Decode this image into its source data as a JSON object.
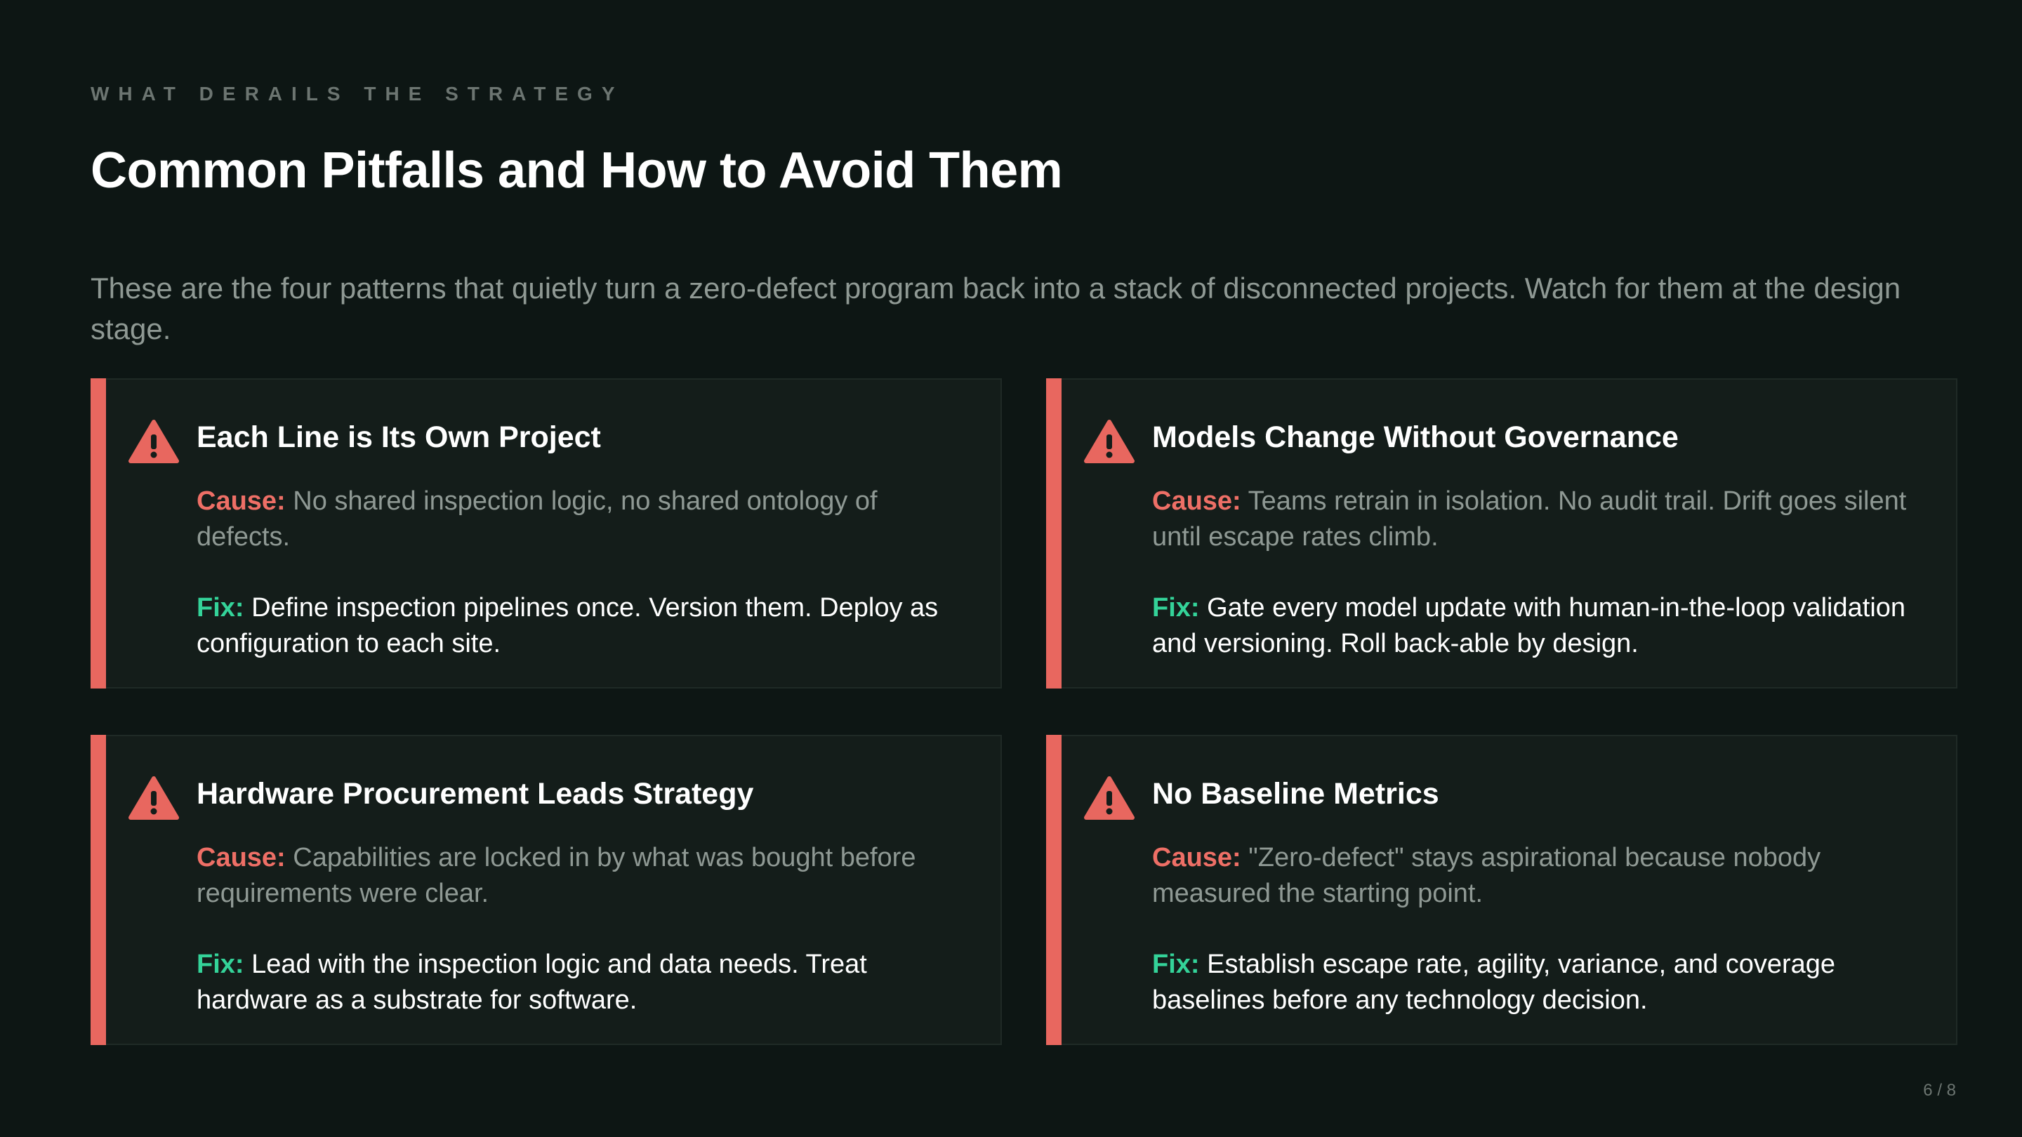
{
  "eyebrow": "WHAT DERAILS THE STRATEGY",
  "title": "Common Pitfalls and How to Avoid Them",
  "subtitle": "These are the four patterns that quietly turn a zero-defect program back into a stack of disconnected projects. Watch for them at the design stage.",
  "colors": {
    "background": "#0d1614",
    "card_background": "#141d1a",
    "accent_red": "#e8675f",
    "fix_green": "#34d399",
    "muted_text": "#8f9994"
  },
  "cards": [
    {
      "icon": "warning-triangle-icon",
      "title": "Each Line is Its Own Project",
      "cause_label": "Cause:",
      "cause_text": "No shared inspection logic, no shared ontology of defects.",
      "fix_label": "Fix:",
      "fix_text": "Define inspection pipelines once. Version them. Deploy as configuration to each site."
    },
    {
      "icon": "warning-triangle-icon",
      "title": "Models Change Without Governance",
      "cause_label": "Cause:",
      "cause_text": "Teams retrain in isolation. No audit trail. Drift goes silent until escape rates climb.",
      "fix_label": "Fix:",
      "fix_text": "Gate every model update with human-in-the-loop validation and versioning. Roll back-able by design."
    },
    {
      "icon": "warning-triangle-icon",
      "title": "Hardware Procurement Leads Strategy",
      "cause_label": "Cause:",
      "cause_text": "Capabilities are locked in by what was bought before requirements were clear.",
      "fix_label": "Fix:",
      "fix_text": "Lead with the inspection logic and data needs. Treat hardware as a substrate for software."
    },
    {
      "icon": "warning-triangle-icon",
      "title": "No Baseline Metrics",
      "cause_label": "Cause:",
      "cause_text": "\"Zero-defect\" stays aspirational because nobody measured the starting point.",
      "fix_label": "Fix:",
      "fix_text": "Establish escape rate, agility, variance, and coverage baselines before any technology decision."
    }
  ],
  "page_number": "6 / 8"
}
